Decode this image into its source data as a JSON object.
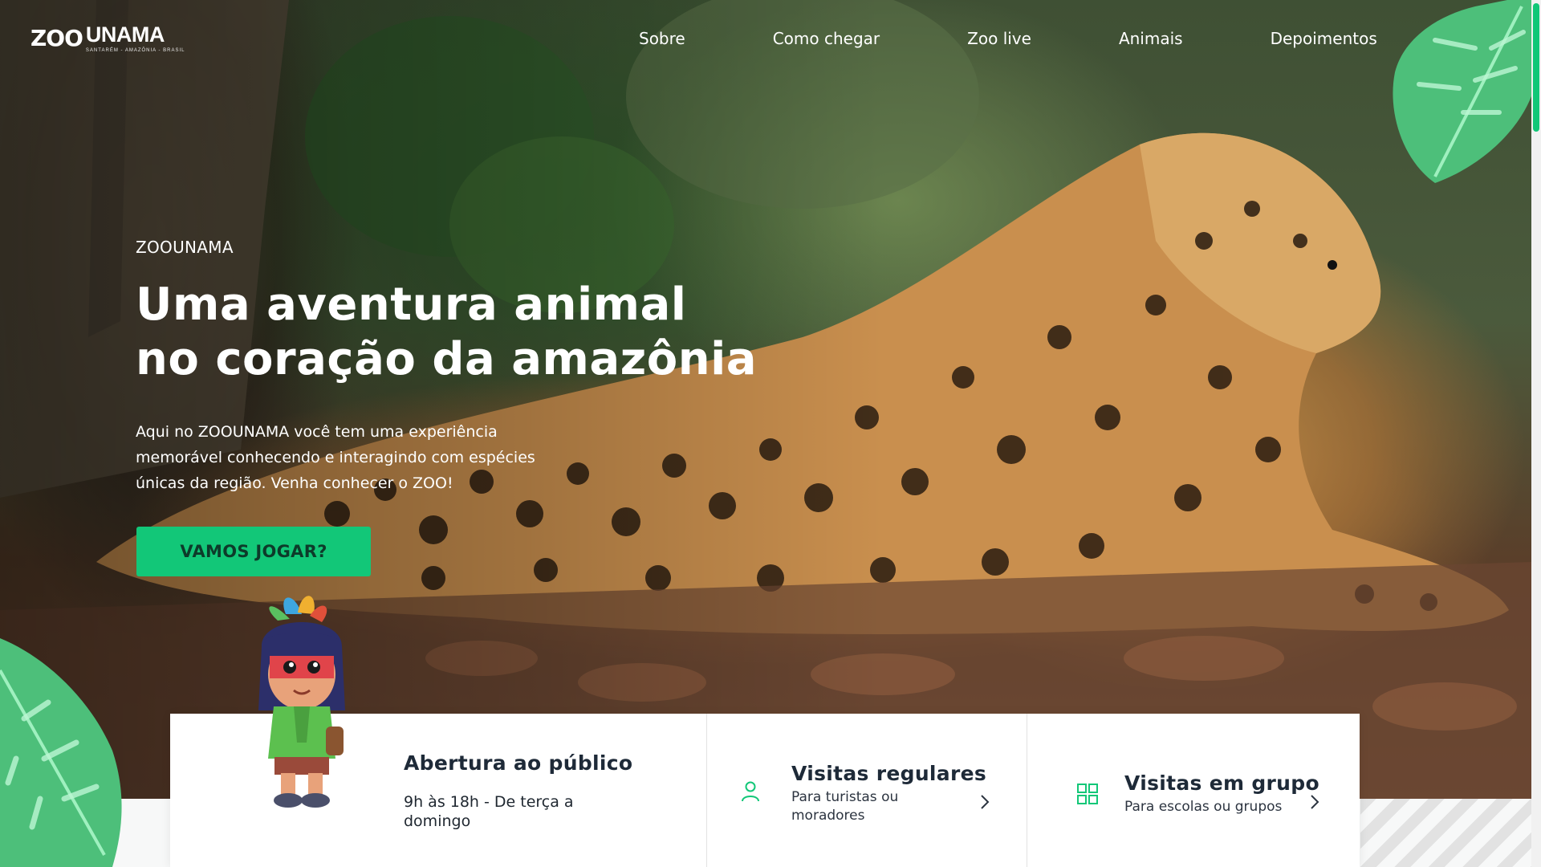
{
  "brand": {
    "logo_mark": "ZOO",
    "logo_title": "UNAMA",
    "logo_subtitle": "SANTARÉM - AMAZÔNIA - BRASIL"
  },
  "nav": {
    "items": [
      "Sobre",
      "Como chegar",
      "Zoo live",
      "Animais",
      "Depoimentos"
    ]
  },
  "hero": {
    "eyebrow": "ZOOUNAMA",
    "headline_line1": "Uma aventura animal",
    "headline_line2": "no coração da amazônia",
    "lead": "Aqui no ZOOUNAMA você tem uma experiência memorável conhecendo e interagindo com espécies únicas da região. Venha conhecer o ZOO!",
    "cta_label": "VAMOS JOGAR?"
  },
  "cards": {
    "opening": {
      "title": "Abertura ao público",
      "subtitle": "9h às 18h - De terça a domingo"
    },
    "regular": {
      "title": "Visitas regulares",
      "subtitle": "Para turistas ou moradores",
      "icon": "user-icon"
    },
    "group": {
      "title": "Visitas em grupo",
      "subtitle": "Para escolas ou grupos",
      "icon": "grid-icon"
    }
  },
  "colors": {
    "accent_green": "#12c778",
    "leaf_green": "#4dbf7a",
    "text_dark": "#1e2a38"
  }
}
